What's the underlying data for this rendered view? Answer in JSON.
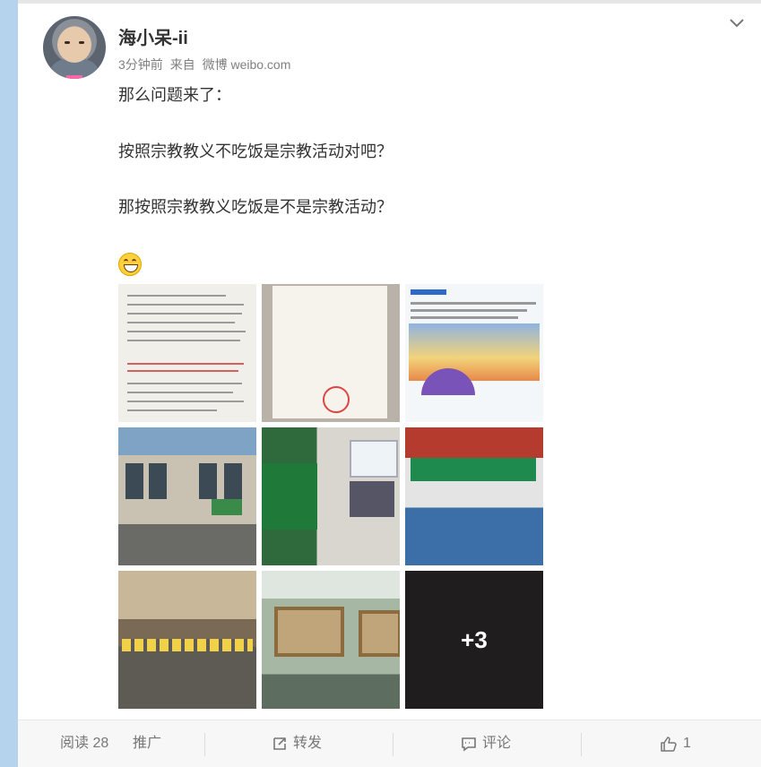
{
  "post": {
    "username": "海小呆-ii",
    "time": "3分钟前",
    "source_prefix": "来自",
    "source": "微博 weibo.com",
    "lines": [
      "那么问题来了：",
      "按照宗教教义不吃饭是宗教活动对吧？",
      "那按照宗教教义吃饭是不是宗教活动？"
    ],
    "emoji_icon": "grin-emoji-icon",
    "images": {
      "more_count": "+3"
    }
  },
  "footer": {
    "reads_label": "阅读 28",
    "promote_label": "推广",
    "repost_label": "转发",
    "comment_label": "评论",
    "like_count": "1"
  },
  "colors": {
    "left_bar": "#b5d3ec",
    "footer_bg": "#f7f7f7",
    "text": "#333333",
    "meta": "#808080"
  }
}
